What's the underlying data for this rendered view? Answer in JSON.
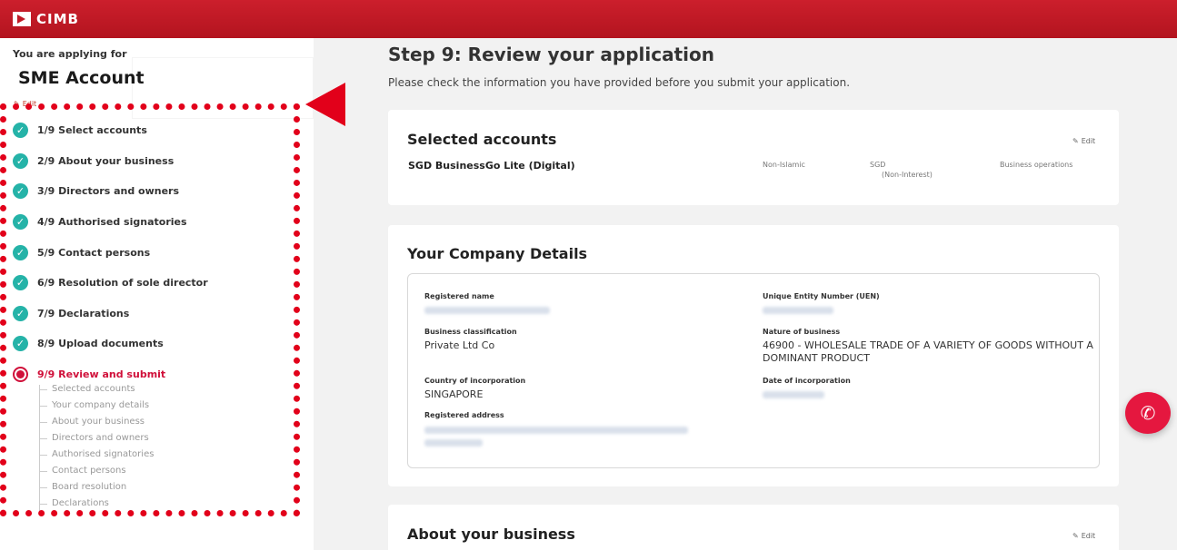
{
  "brand": {
    "name": "CIMB"
  },
  "sidebar": {
    "applying_label": "You are applying for",
    "product": "SME Account",
    "edit_label": "Edit",
    "steps": [
      {
        "label": "1/9 Select accounts",
        "state": "done"
      },
      {
        "label": "2/9 About your business",
        "state": "done"
      },
      {
        "label": "3/9 Directors and owners",
        "state": "done"
      },
      {
        "label": "4/9 Authorised signatories",
        "state": "done"
      },
      {
        "label": "5/9 Contact persons",
        "state": "done"
      },
      {
        "label": "6/9 Resolution of sole director",
        "state": "done"
      },
      {
        "label": "7/9 Declarations",
        "state": "done"
      },
      {
        "label": "8/9 Upload documents",
        "state": "done"
      },
      {
        "label": "9/9 Review and submit",
        "state": "active"
      }
    ],
    "substeps": [
      "Selected accounts",
      "Your company details",
      "About your business",
      "Directors and owners",
      "Authorised signatories",
      "Contact persons",
      "Board resolution",
      "Declarations"
    ]
  },
  "main": {
    "title": "Step 9: Review your application",
    "subtitle": "Please check the information you have provided before you submit your application.",
    "selected_accounts": {
      "title": "Selected accounts",
      "edit_label": "Edit",
      "account_name": "SGD BusinessGo Lite (Digital)",
      "type": "Non-Islamic",
      "currency": "SGD",
      "interest": "(Non-Interest)",
      "purpose": "Business operations"
    },
    "company_details": {
      "title": "Your Company Details",
      "registered_name_label": "Registered name",
      "uen_label": "Unique Entity Number (UEN)",
      "business_classification_label": "Business classification",
      "business_classification": "Private Ltd Co",
      "nature_label": "Nature of business",
      "nature_line1": "46900 - WHOLESALE TRADE OF A VARIETY OF GOODS WITHOUT A",
      "nature_line2": "DOMINANT PRODUCT",
      "country_label": "Country of incorporation",
      "country": "SINGAPORE",
      "date_label": "Date of incorporation",
      "address_label": "Registered address"
    },
    "about_business": {
      "title": "About your business",
      "edit_label": "Edit"
    }
  },
  "icons": {
    "call": "phone-call-icon",
    "edit": "pencil-icon",
    "check": "check-icon"
  },
  "colors": {
    "brand_red": "#c01a26",
    "done_teal": "#25b3a8",
    "active_red": "#d0103a",
    "highlight": "#e2001a"
  }
}
